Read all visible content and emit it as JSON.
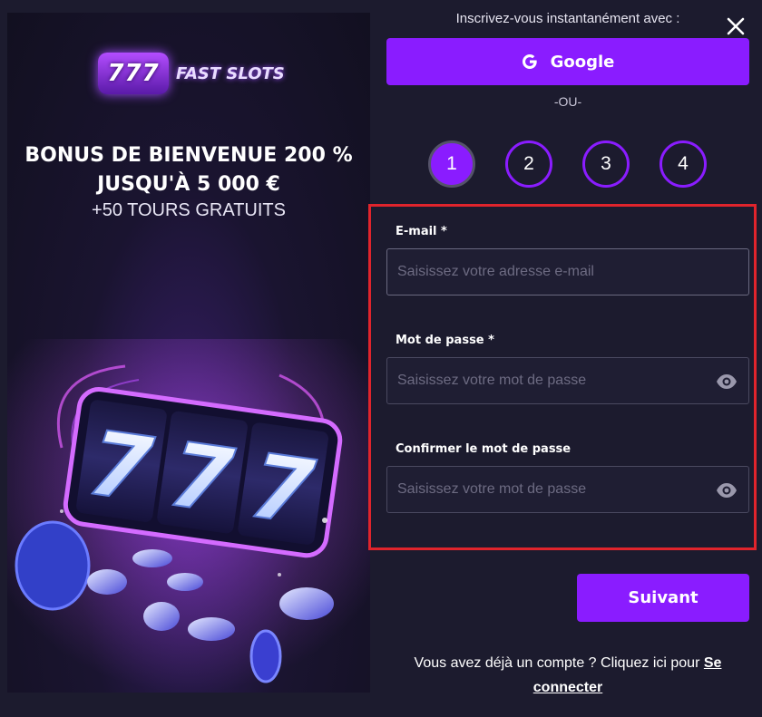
{
  "promo": {
    "logo_digits": "777",
    "logo_text": "FAST SLOTS",
    "title_line1": "BONUS DE BIENVENUE 200 %",
    "title_line2": "JUSQU'À 5 000 €",
    "subtitle": "+50 TOURS GRATUITS"
  },
  "signup": {
    "heading": "Inscrivez-vous instantanément avec :",
    "google_label": "Google",
    "or_label": "-OU-"
  },
  "steps": {
    "items": [
      "1",
      "2",
      "3",
      "4"
    ],
    "active": 1
  },
  "form": {
    "email_label": "E-mail *",
    "email_placeholder": "Saisissez votre adresse e-mail",
    "email_value": "",
    "password_label": "Mot de passe *",
    "password_placeholder": "Saisissez votre mot de passe",
    "confirm_label": "Confirmer le mot de passe",
    "confirm_placeholder": "Saisissez votre mot de passe",
    "next_label": "Suivant"
  },
  "footer": {
    "prompt": "Vous avez déjà un compte ? Cliquez ici pour",
    "link_label": "Se connecter"
  },
  "colors": {
    "accent": "#8a1cff",
    "background": "#1c1b2e",
    "highlight_border": "#e0242c",
    "input_bg": "#1f1e33"
  },
  "icons": {
    "close": "close-icon",
    "google": "google-icon",
    "eye": "eye-icon"
  }
}
